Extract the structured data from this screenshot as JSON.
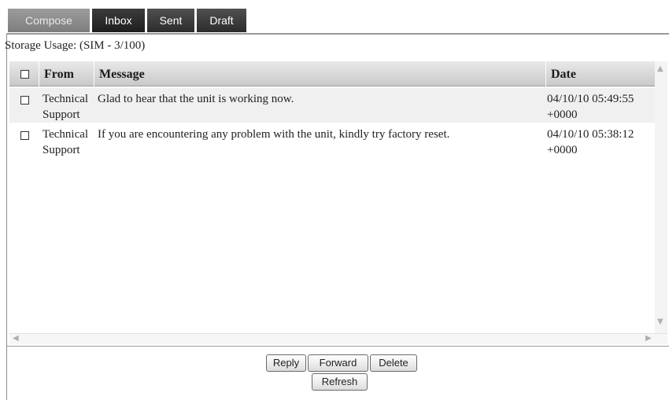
{
  "tabs": {
    "compose": "Compose",
    "inbox": "Inbox",
    "sent": "Sent",
    "draft": "Draft"
  },
  "storage_usage": "Storage Usage: (SIM - 3/100)",
  "columns": {
    "from": "From",
    "message": "Message",
    "date": "Date"
  },
  "messages": [
    {
      "from_line1": "Technical",
      "from_line2": "Support",
      "message": "Glad to hear that the unit is working now.",
      "date_line1": "04/10/10 05:49:55",
      "date_line2": "+0000"
    },
    {
      "from_line1": "Technical",
      "from_line2": "Support",
      "message": "If you are encountering any problem with the unit, kindly try factory reset.",
      "date_line1": "04/10/10 05:38:12",
      "date_line2": "+0000"
    }
  ],
  "buttons": {
    "reply": "Reply",
    "forward": "Forward",
    "delete": "Delete",
    "refresh": "Refresh"
  },
  "icons": {
    "scroll_up": "scroll-up-arrow",
    "scroll_down": "scroll-down-arrow",
    "scroll_left": "scroll-left-arrow",
    "scroll_right": "scroll-right-arrow"
  }
}
